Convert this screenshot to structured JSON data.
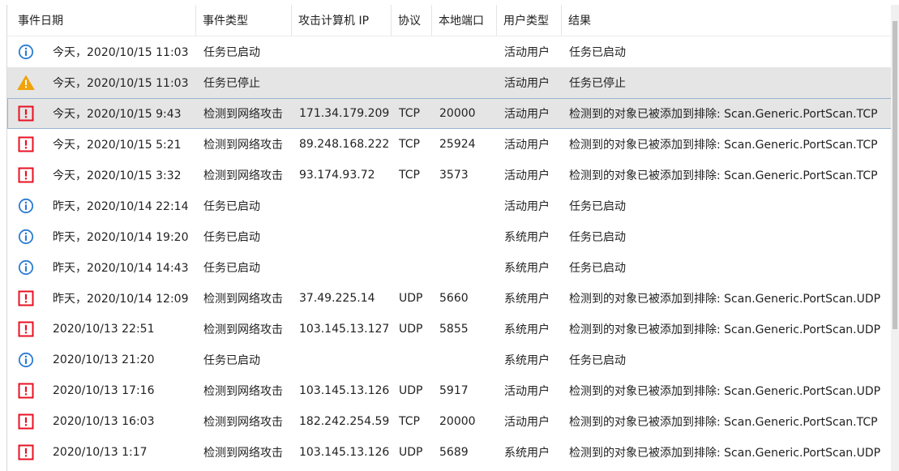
{
  "columns": {
    "date": "事件日期",
    "type": "事件类型",
    "ip": "攻击计算机 IP",
    "protocol": "协议",
    "port": "本地端口",
    "user": "用户类型",
    "result": "结果"
  },
  "colors": {
    "info": "#2b7cd3",
    "warning": "#f0a30a",
    "alert": "#e81123",
    "selected_row": "#e5e5e5",
    "focus_border": "#99b4d1"
  },
  "rows": [
    {
      "icon": "info-icon",
      "date": "今天，2020/10/15 11:03",
      "type": "任务已启动",
      "ip": "",
      "protocol": "",
      "port": "",
      "user": "活动用户",
      "result": "任务已启动"
    },
    {
      "icon": "warning-icon",
      "date": "今天，2020/10/15 11:03",
      "type": "任务已停止",
      "ip": "",
      "protocol": "",
      "port": "",
      "user": "活动用户",
      "result": "任务已停止"
    },
    {
      "icon": "alert-icon",
      "date": "今天，2020/10/15 9:43",
      "type": "检测到网络攻击",
      "ip": "171.34.179.209",
      "protocol": "TCP",
      "port": "20000",
      "user": "活动用户",
      "result": "检测到的对象已被添加到排除: Scan.Generic.PortScan.TCP"
    },
    {
      "icon": "alert-icon",
      "date": "今天，2020/10/15 5:21",
      "type": "检测到网络攻击",
      "ip": "89.248.168.222",
      "protocol": "TCP",
      "port": "25924",
      "user": "活动用户",
      "result": "检测到的对象已被添加到排除: Scan.Generic.PortScan.TCP"
    },
    {
      "icon": "alert-icon",
      "date": "今天，2020/10/15 3:32",
      "type": "检测到网络攻击",
      "ip": "93.174.93.72",
      "protocol": "TCP",
      "port": "3573",
      "user": "活动用户",
      "result": "检测到的对象已被添加到排除: Scan.Generic.PortScan.TCP"
    },
    {
      "icon": "info-icon",
      "date": "昨天，2020/10/14 22:14",
      "type": "任务已启动",
      "ip": "",
      "protocol": "",
      "port": "",
      "user": "活动用户",
      "result": "任务已启动"
    },
    {
      "icon": "info-icon",
      "date": "昨天，2020/10/14 19:20",
      "type": "任务已启动",
      "ip": "",
      "protocol": "",
      "port": "",
      "user": "系统用户",
      "result": "任务已启动"
    },
    {
      "icon": "info-icon",
      "date": "昨天，2020/10/14 14:43",
      "type": "任务已启动",
      "ip": "",
      "protocol": "",
      "port": "",
      "user": "系统用户",
      "result": "任务已启动"
    },
    {
      "icon": "alert-icon",
      "date": "昨天，2020/10/14 12:09",
      "type": "检测到网络攻击",
      "ip": "37.49.225.14",
      "protocol": "UDP",
      "port": "5660",
      "user": "系统用户",
      "result": "检测到的对象已被添加到排除: Scan.Generic.PortScan.UDP"
    },
    {
      "icon": "alert-icon",
      "date": "2020/10/13 22:51",
      "type": "检测到网络攻击",
      "ip": "103.145.13.127",
      "protocol": "UDP",
      "port": "5855",
      "user": "系统用户",
      "result": "检测到的对象已被添加到排除: Scan.Generic.PortScan.UDP"
    },
    {
      "icon": "info-icon",
      "date": "2020/10/13 21:20",
      "type": "任务已启动",
      "ip": "",
      "protocol": "",
      "port": "",
      "user": "系统用户",
      "result": "任务已启动"
    },
    {
      "icon": "alert-icon",
      "date": "2020/10/13 17:16",
      "type": "检测到网络攻击",
      "ip": "103.145.13.126",
      "protocol": "UDP",
      "port": "5917",
      "user": "活动用户",
      "result": "检测到的对象已被添加到排除: Scan.Generic.PortScan.UDP"
    },
    {
      "icon": "alert-icon",
      "date": "2020/10/13 16:03",
      "type": "检测到网络攻击",
      "ip": "182.242.254.59",
      "protocol": "TCP",
      "port": "20000",
      "user": "活动用户",
      "result": "检测到的对象已被添加到排除: Scan.Generic.PortScan.TCP"
    },
    {
      "icon": "alert-icon",
      "date": "2020/10/13 1:17",
      "type": "检测到网络攻击",
      "ip": "103.145.13.126",
      "protocol": "UDP",
      "port": "5689",
      "user": "系统用户",
      "result": "检测到的对象已被添加到排除: Scan.Generic.PortScan.UDP"
    }
  ],
  "selection": {
    "selected_row": 1,
    "focused_row": 2
  }
}
